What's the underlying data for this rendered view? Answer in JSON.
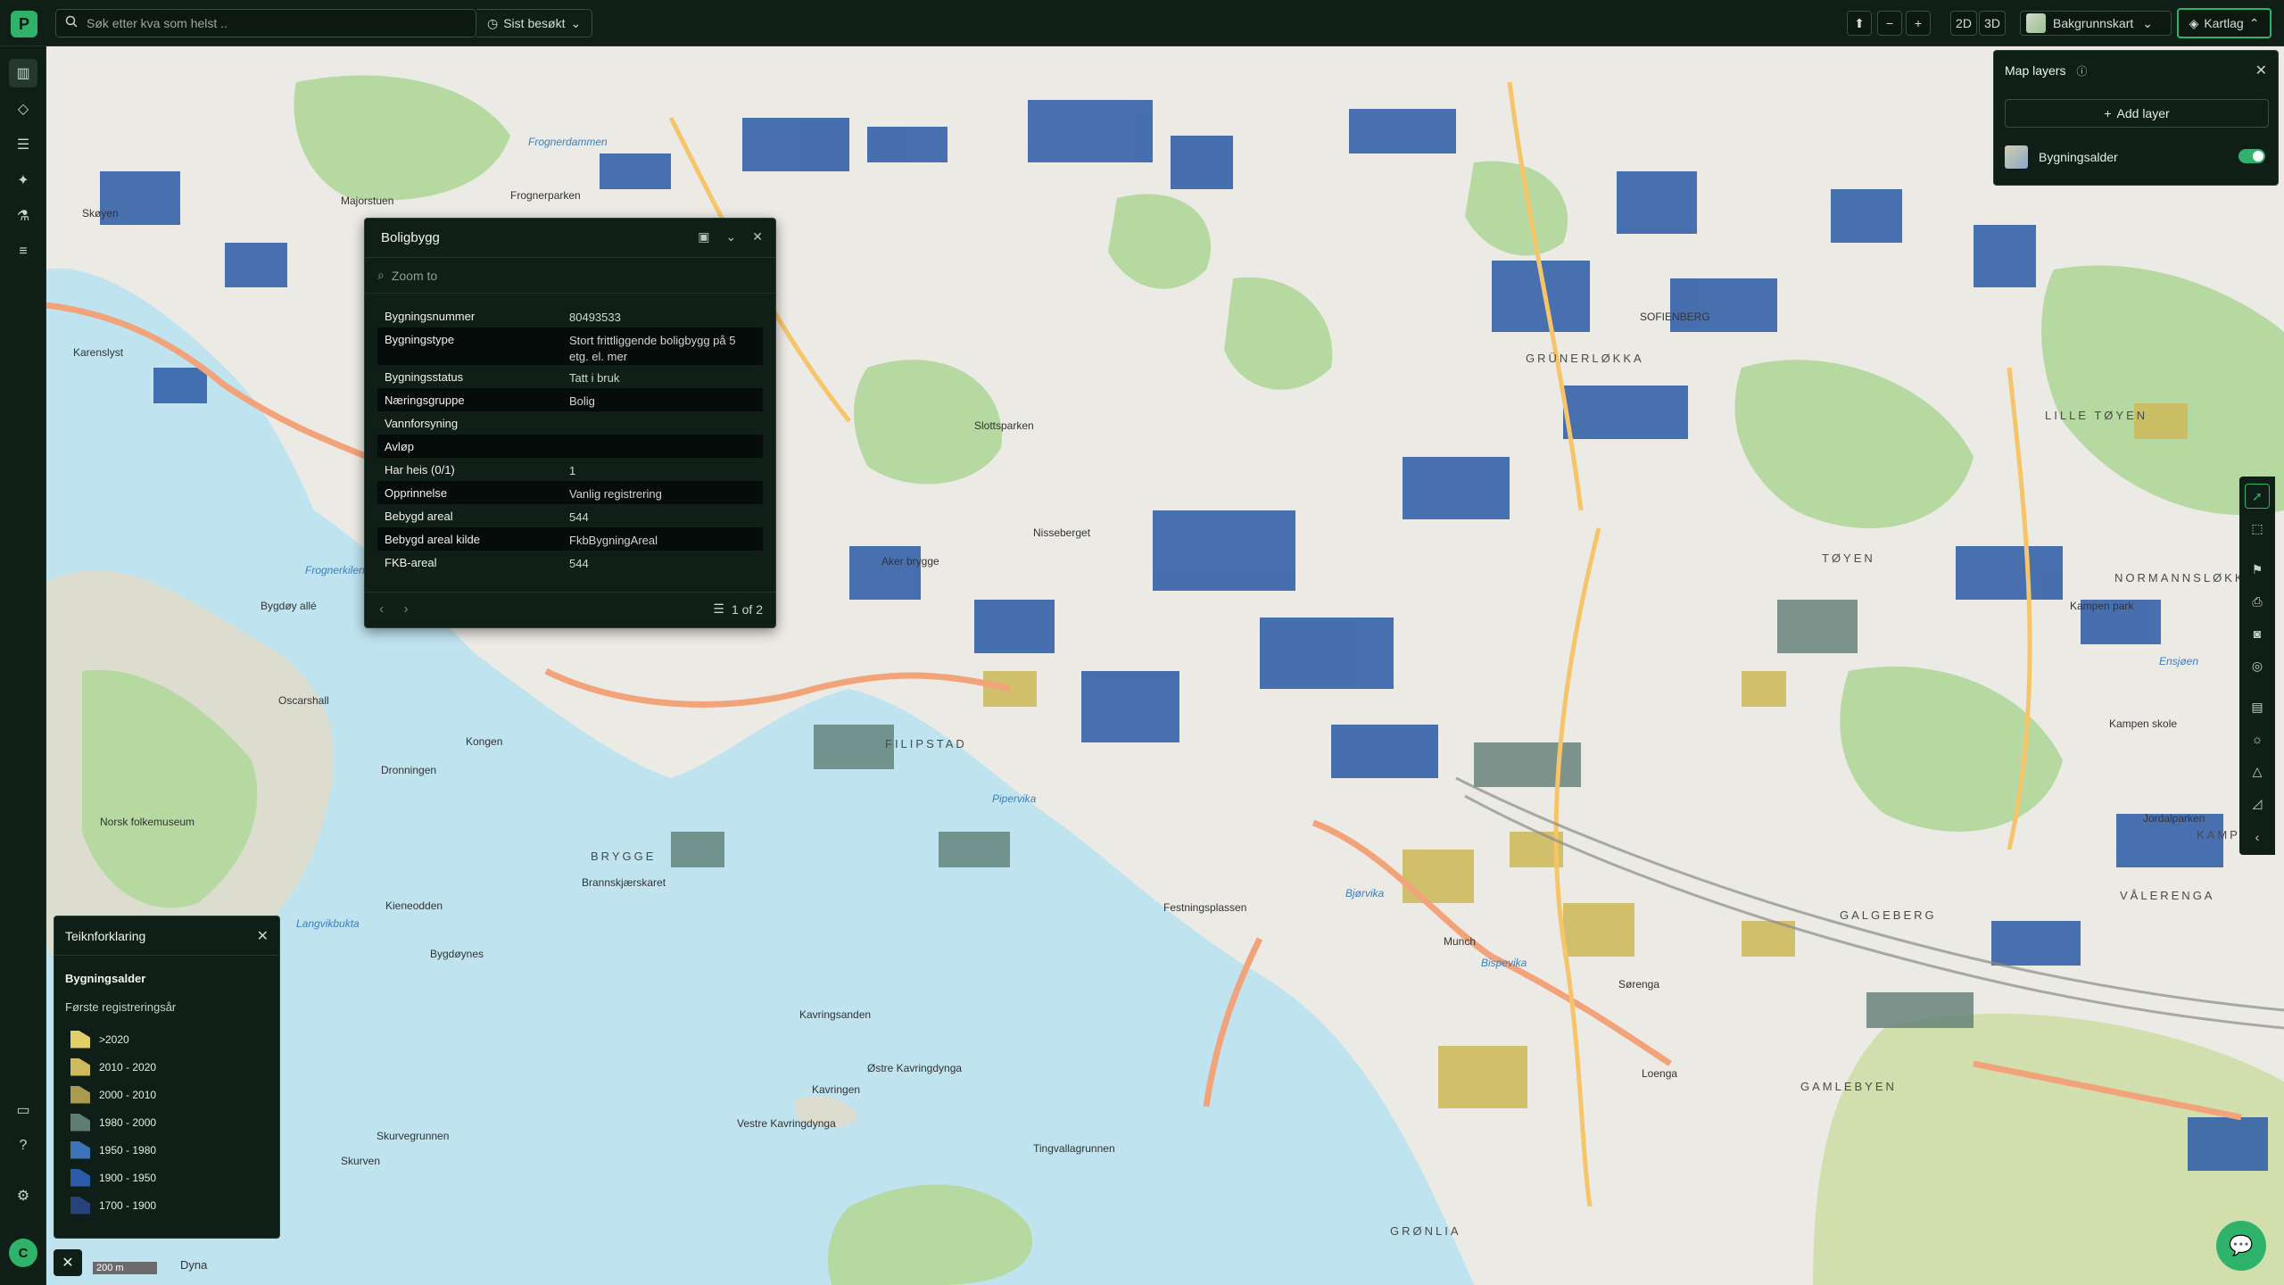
{
  "app": {
    "logo_letter": "P"
  },
  "search": {
    "placeholder": "Søk etter kva som helst ..",
    "recent_label": "Sist besøkt"
  },
  "toolbar": {
    "zoom_out": "−",
    "zoom_in": "+",
    "mode_2d": "2D",
    "mode_3d": "3D",
    "basemap_label": "Bakgrunnskart",
    "layers_label": "Kartlag"
  },
  "feature_panel": {
    "title": "Boligbygg",
    "zoom_placeholder": "Zoom to",
    "rows": [
      {
        "key": "Bygningsnummer",
        "value": "80493533"
      },
      {
        "key": "Bygningstype",
        "value": "Stort frittliggende boligbygg på 5 etg. el. mer"
      },
      {
        "key": "Bygningsstatus",
        "value": "Tatt i bruk"
      },
      {
        "key": "Næringsgruppe",
        "value": "Bolig"
      },
      {
        "key": "Vannforsyning",
        "value": ""
      },
      {
        "key": "Avløp",
        "value": ""
      },
      {
        "key": "Har heis (0/1)",
        "value": "1"
      },
      {
        "key": "Opprinnelse",
        "value": "Vanlig registrering"
      },
      {
        "key": "Bebygd areal",
        "value": "544"
      },
      {
        "key": "Bebygd areal kilde",
        "value": "FkbBygningAreal"
      },
      {
        "key": "FKB-areal",
        "value": "544"
      }
    ],
    "pager": "1 of 2"
  },
  "layers_panel": {
    "title": "Map layers",
    "add_label": "Add layer",
    "layers": [
      {
        "name": "Bygningsalder",
        "enabled": true
      }
    ]
  },
  "legend": {
    "title": "Teiknforklaring",
    "layer": "Bygningsalder",
    "subtitle": "Første registreringsår",
    "items": [
      {
        "label": ">2020",
        "color": "#e2cf6a"
      },
      {
        "label": "2010 - 2020",
        "color": "#cdbb5e"
      },
      {
        "label": "2000 - 2010",
        "color": "#a89a4e"
      },
      {
        "label": "1980 - 2000",
        "color": "#5f7d74"
      },
      {
        "label": "1950 - 1980",
        "color": "#3f73b8"
      },
      {
        "label": "1900 - 1950",
        "color": "#2b5aa6"
      },
      {
        "label": "1700 - 1900",
        "color": "#24437a"
      }
    ]
  },
  "scale": {
    "bar_label": "200 m",
    "status": "Dyna"
  },
  "map_labels": {
    "places": [
      "Frognerdammen",
      "Frognerparken",
      "Majorstuen",
      "Skøyen",
      "Karenslyst",
      "Frognerkilen",
      "Bygdøy allé",
      "Oscarshall",
      "Norsk folkemuseum",
      "Dronningen",
      "Kongen",
      "Kieneodden",
      "Langvikbukta",
      "Bygdøynes",
      "Slottsparken",
      "Nisseberget",
      "Aker brygge",
      "Pipervika",
      "Brannskjærskaret",
      "Festningsplassen",
      "Bjørvika",
      "Kavringsanden",
      "Østre Kavringdynga",
      "Vestre Kavringdynga",
      "Kavringen",
      "Tingvallagrunnen",
      "Skurvegrunnen",
      "Skurven",
      "Munch",
      "Bispevika",
      "Sørenga",
      "Loenga",
      "Jordalparken",
      "Kampen skole",
      "Kampen park",
      "Ensjøen"
    ],
    "districts": [
      "GRÜNERLØKKA",
      "TØYEN",
      "LILLE TØYEN",
      "NORMANNSLØKKA",
      "KAMPEN",
      "VÅLERENGA",
      "GAMLEBYEN",
      "GRØNLIA",
      "FILIPSTAD",
      "BRYGGE",
      "SOFIENBERG",
      "GALGEBERG"
    ]
  }
}
